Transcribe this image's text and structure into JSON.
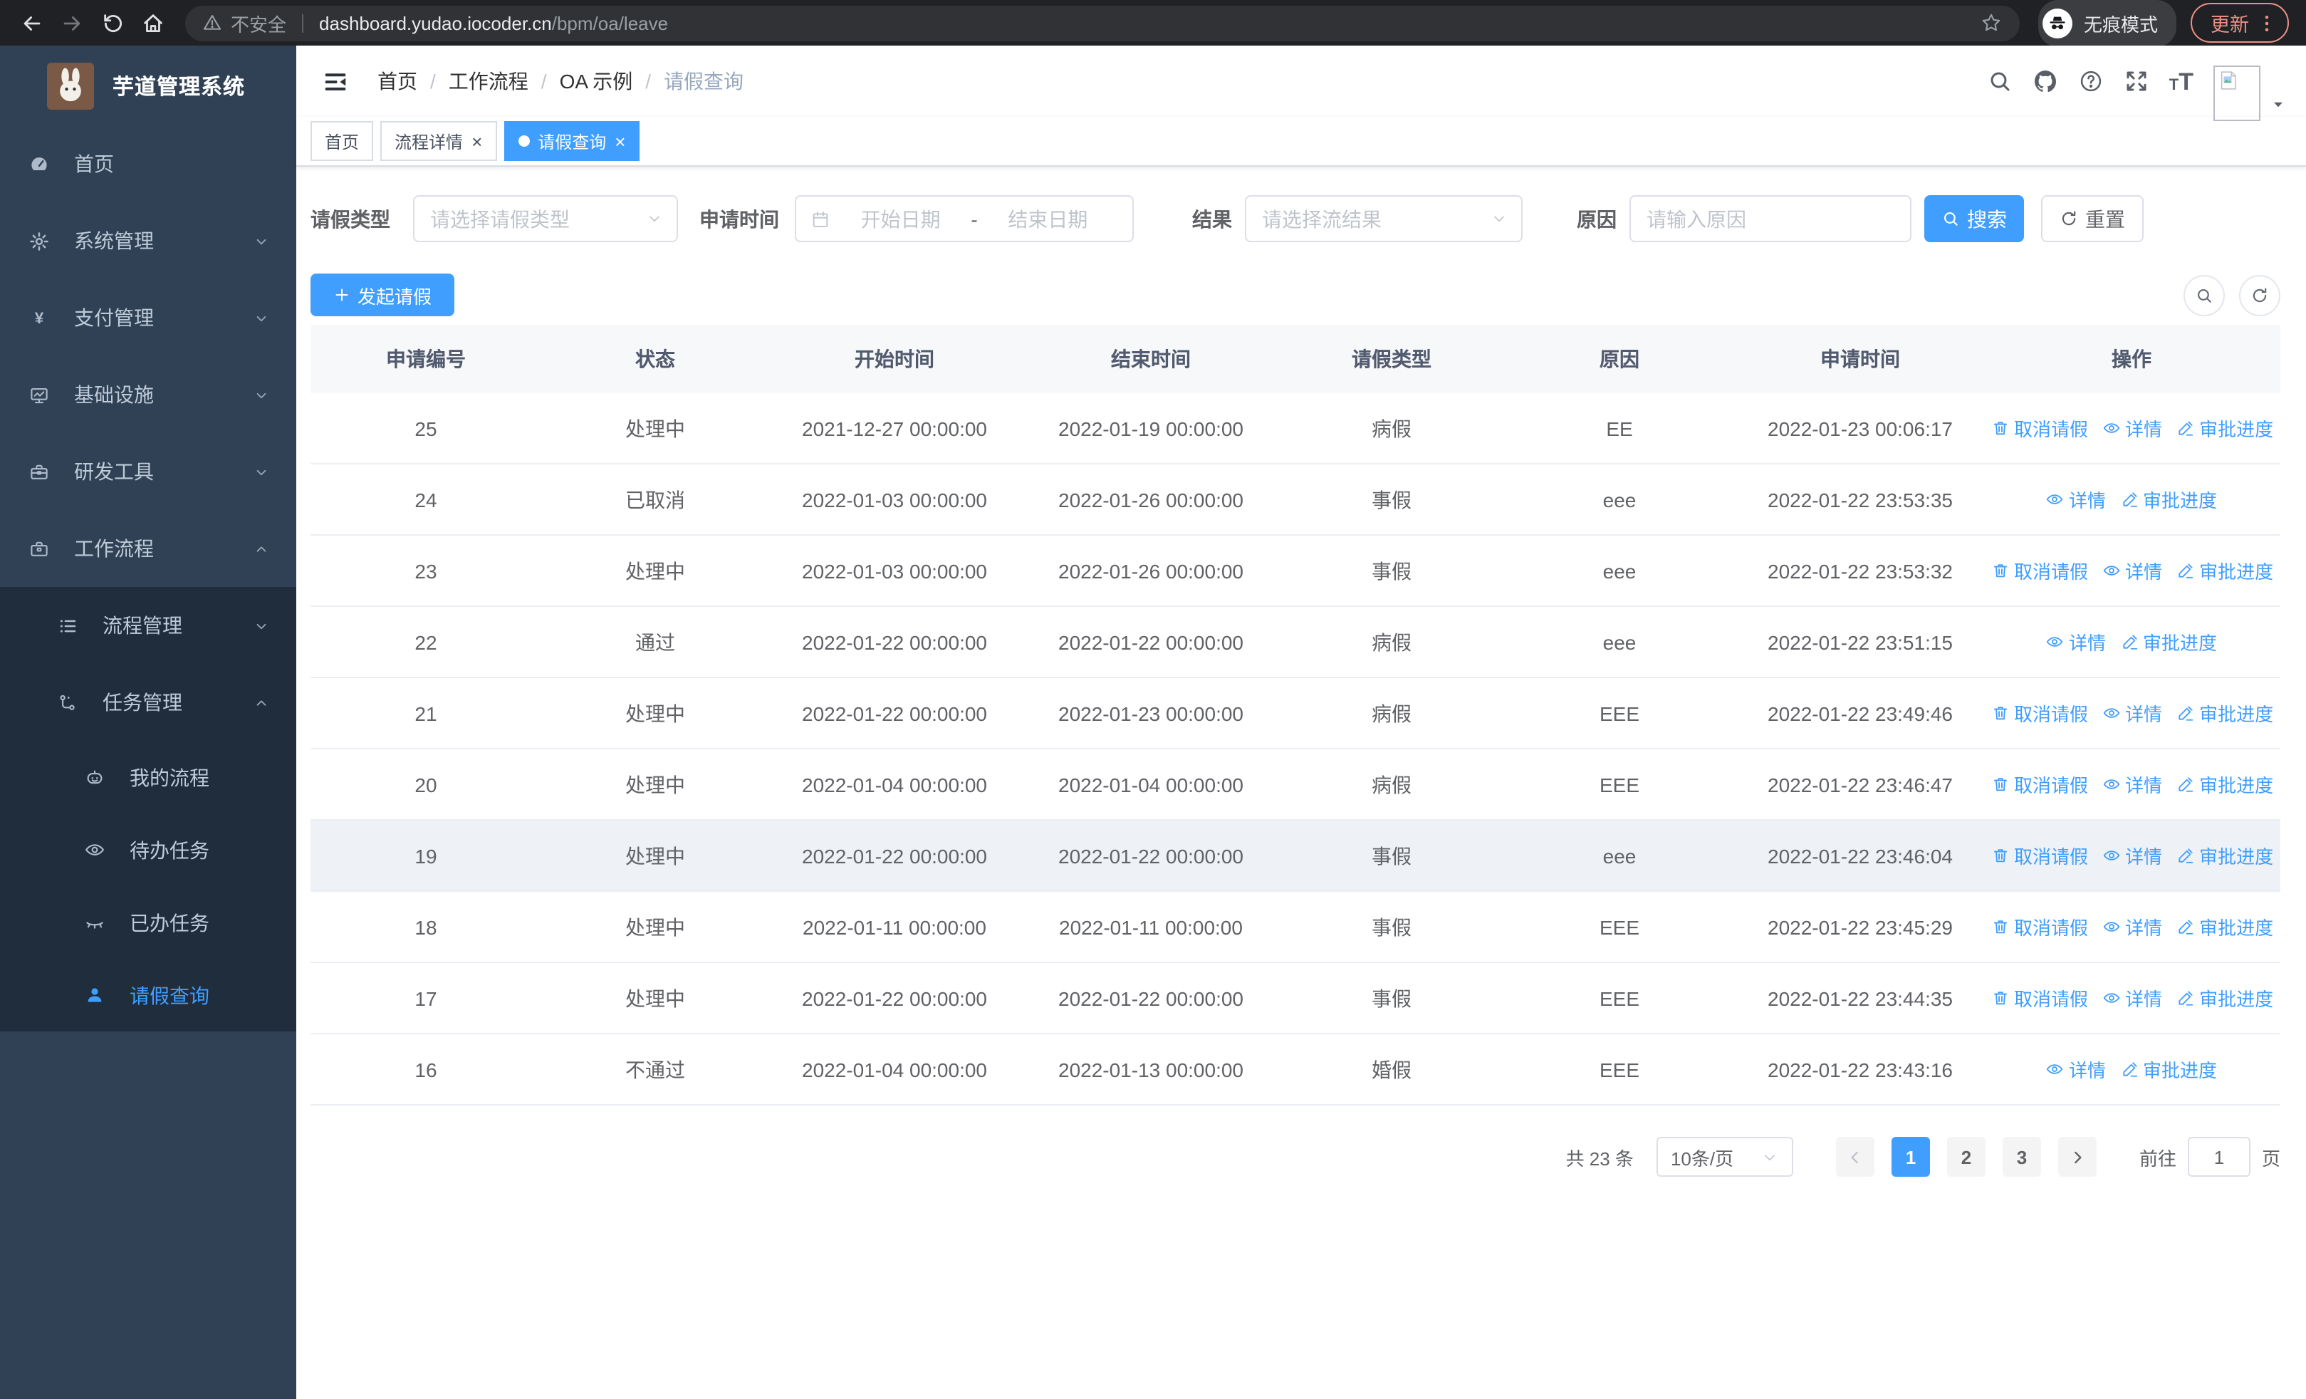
{
  "browser": {
    "security_label": "不安全",
    "url_host": "dashboard.yudao.iocoder.cn",
    "url_path": "/bpm/oa/leave",
    "incognito_label": "无痕模式",
    "update_label": "更新"
  },
  "colors": {
    "accent": "#409eff",
    "sidebar_bg": "#304156",
    "sidebar_nested_bg": "#1f2d3d",
    "update_badge": "#ee9086"
  },
  "sidebar": {
    "title": "芋道管理系统",
    "items": [
      {
        "name": "home",
        "label": "首页",
        "icon": "dashboard-icon",
        "depth": 0,
        "arrow": "",
        "nested": false,
        "active": false
      },
      {
        "name": "system-management",
        "label": "系统管理",
        "icon": "gear-icon",
        "depth": 0,
        "arrow": "down",
        "nested": false,
        "active": false
      },
      {
        "name": "payment-management",
        "label": "支付管理",
        "icon": "yen-icon",
        "depth": 0,
        "arrow": "down",
        "nested": false,
        "active": false
      },
      {
        "name": "infrastructure",
        "label": "基础设施",
        "icon": "monitor-icon",
        "depth": 0,
        "arrow": "down",
        "nested": false,
        "active": false
      },
      {
        "name": "dev-tools",
        "label": "研发工具",
        "icon": "toolbox-icon",
        "depth": 0,
        "arrow": "down",
        "nested": false,
        "active": false
      },
      {
        "name": "workflow",
        "label": "工作流程",
        "icon": "briefcase-icon",
        "depth": 0,
        "arrow": "up",
        "nested": false,
        "active": false
      },
      {
        "name": "process-management",
        "label": "流程管理",
        "icon": "list-tree-icon",
        "depth": 1,
        "arrow": "down",
        "nested": true,
        "active": false
      },
      {
        "name": "task-management",
        "label": "任务管理",
        "icon": "flow-icon",
        "depth": 1,
        "arrow": "up",
        "nested": true,
        "active": false
      },
      {
        "name": "my-process",
        "label": "我的流程",
        "icon": "face-icon",
        "depth": 2,
        "arrow": "",
        "nested": true,
        "active": false
      },
      {
        "name": "todo-tasks",
        "label": "待办任务",
        "icon": "eye-open-icon",
        "depth": 2,
        "arrow": "",
        "nested": true,
        "active": false
      },
      {
        "name": "done-tasks",
        "label": "已办任务",
        "icon": "eye-closed-icon",
        "depth": 2,
        "arrow": "",
        "nested": true,
        "active": false
      },
      {
        "name": "leave-query",
        "label": "请假查询",
        "icon": "user-icon",
        "depth": 2,
        "arrow": "",
        "nested": true,
        "active": true
      }
    ]
  },
  "header": {
    "breadcrumb": [
      "首页",
      "工作流程",
      "OA 示例",
      "请假查询"
    ]
  },
  "tabs": [
    {
      "name": "tab-home",
      "label": "首页",
      "active": false,
      "closable": false
    },
    {
      "name": "tab-process-detail",
      "label": "流程详情",
      "active": false,
      "closable": true
    },
    {
      "name": "tab-leave-query",
      "label": "请假查询",
      "active": true,
      "closable": true
    }
  ],
  "filters": {
    "leave_type_label": "请假类型",
    "leave_type_placeholder": "请选择请假类型",
    "apply_time_label": "申请时间",
    "start_date_placeholder": "开始日期",
    "range_separator": "-",
    "end_date_placeholder": "结束日期",
    "result_label": "结果",
    "result_placeholder": "请选择流结果",
    "reason_label": "原因",
    "reason_placeholder": "请输入原因",
    "search_button": "搜索",
    "reset_button": "重置"
  },
  "toolbar": {
    "create_button": "发起请假"
  },
  "table": {
    "columns": [
      "申请编号",
      "状态",
      "开始时间",
      "结束时间",
      "请假类型",
      "原因",
      "申请时间",
      "操作"
    ],
    "action_labels": {
      "cancel": "取消请假",
      "detail": "详情",
      "progress": "审批进度"
    },
    "rows": [
      {
        "id": "25",
        "status": "处理中",
        "start": "2021-12-27 00:00:00",
        "end": "2022-01-19 00:00:00",
        "type": "病假",
        "reason": "EE",
        "applied": "2022-01-23 00:06:17",
        "actions": [
          "cancel",
          "detail",
          "progress"
        ],
        "highlight": false
      },
      {
        "id": "24",
        "status": "已取消",
        "start": "2022-01-03 00:00:00",
        "end": "2022-01-26 00:00:00",
        "type": "事假",
        "reason": "eee",
        "applied": "2022-01-22 23:53:35",
        "actions": [
          "detail",
          "progress"
        ],
        "highlight": false
      },
      {
        "id": "23",
        "status": "处理中",
        "start": "2022-01-03 00:00:00",
        "end": "2022-01-26 00:00:00",
        "type": "事假",
        "reason": "eee",
        "applied": "2022-01-22 23:53:32",
        "actions": [
          "cancel",
          "detail",
          "progress"
        ],
        "highlight": false
      },
      {
        "id": "22",
        "status": "通过",
        "start": "2022-01-22 00:00:00",
        "end": "2022-01-22 00:00:00",
        "type": "病假",
        "reason": "eee",
        "applied": "2022-01-22 23:51:15",
        "actions": [
          "detail",
          "progress"
        ],
        "highlight": false
      },
      {
        "id": "21",
        "status": "处理中",
        "start": "2022-01-22 00:00:00",
        "end": "2022-01-23 00:00:00",
        "type": "病假",
        "reason": "EEE",
        "applied": "2022-01-22 23:49:46",
        "actions": [
          "cancel",
          "detail",
          "progress"
        ],
        "highlight": false
      },
      {
        "id": "20",
        "status": "处理中",
        "start": "2022-01-04 00:00:00",
        "end": "2022-01-04 00:00:00",
        "type": "病假",
        "reason": "EEE",
        "applied": "2022-01-22 23:46:47",
        "actions": [
          "cancel",
          "detail",
          "progress"
        ],
        "highlight": false
      },
      {
        "id": "19",
        "status": "处理中",
        "start": "2022-01-22 00:00:00",
        "end": "2022-01-22 00:00:00",
        "type": "事假",
        "reason": "eee",
        "applied": "2022-01-22 23:46:04",
        "actions": [
          "cancel",
          "detail",
          "progress"
        ],
        "highlight": true
      },
      {
        "id": "18",
        "status": "处理中",
        "start": "2022-01-11 00:00:00",
        "end": "2022-01-11 00:00:00",
        "type": "事假",
        "reason": "EEE",
        "applied": "2022-01-22 23:45:29",
        "actions": [
          "cancel",
          "detail",
          "progress"
        ],
        "highlight": false
      },
      {
        "id": "17",
        "status": "处理中",
        "start": "2022-01-22 00:00:00",
        "end": "2022-01-22 00:00:00",
        "type": "事假",
        "reason": "EEE",
        "applied": "2022-01-22 23:44:35",
        "actions": [
          "cancel",
          "detail",
          "progress"
        ],
        "highlight": false
      },
      {
        "id": "16",
        "status": "不通过",
        "start": "2022-01-04 00:00:00",
        "end": "2022-01-13 00:00:00",
        "type": "婚假",
        "reason": "EEE",
        "applied": "2022-01-22 23:43:16",
        "actions": [
          "detail",
          "progress"
        ],
        "highlight": false
      }
    ]
  },
  "pagination": {
    "total_text": "共 23 条",
    "page_size_text": "10条/页",
    "pages": [
      "1",
      "2",
      "3"
    ],
    "active_page": "1",
    "goto_label": "前往",
    "goto_value": "1",
    "goto_suffix": "页"
  }
}
